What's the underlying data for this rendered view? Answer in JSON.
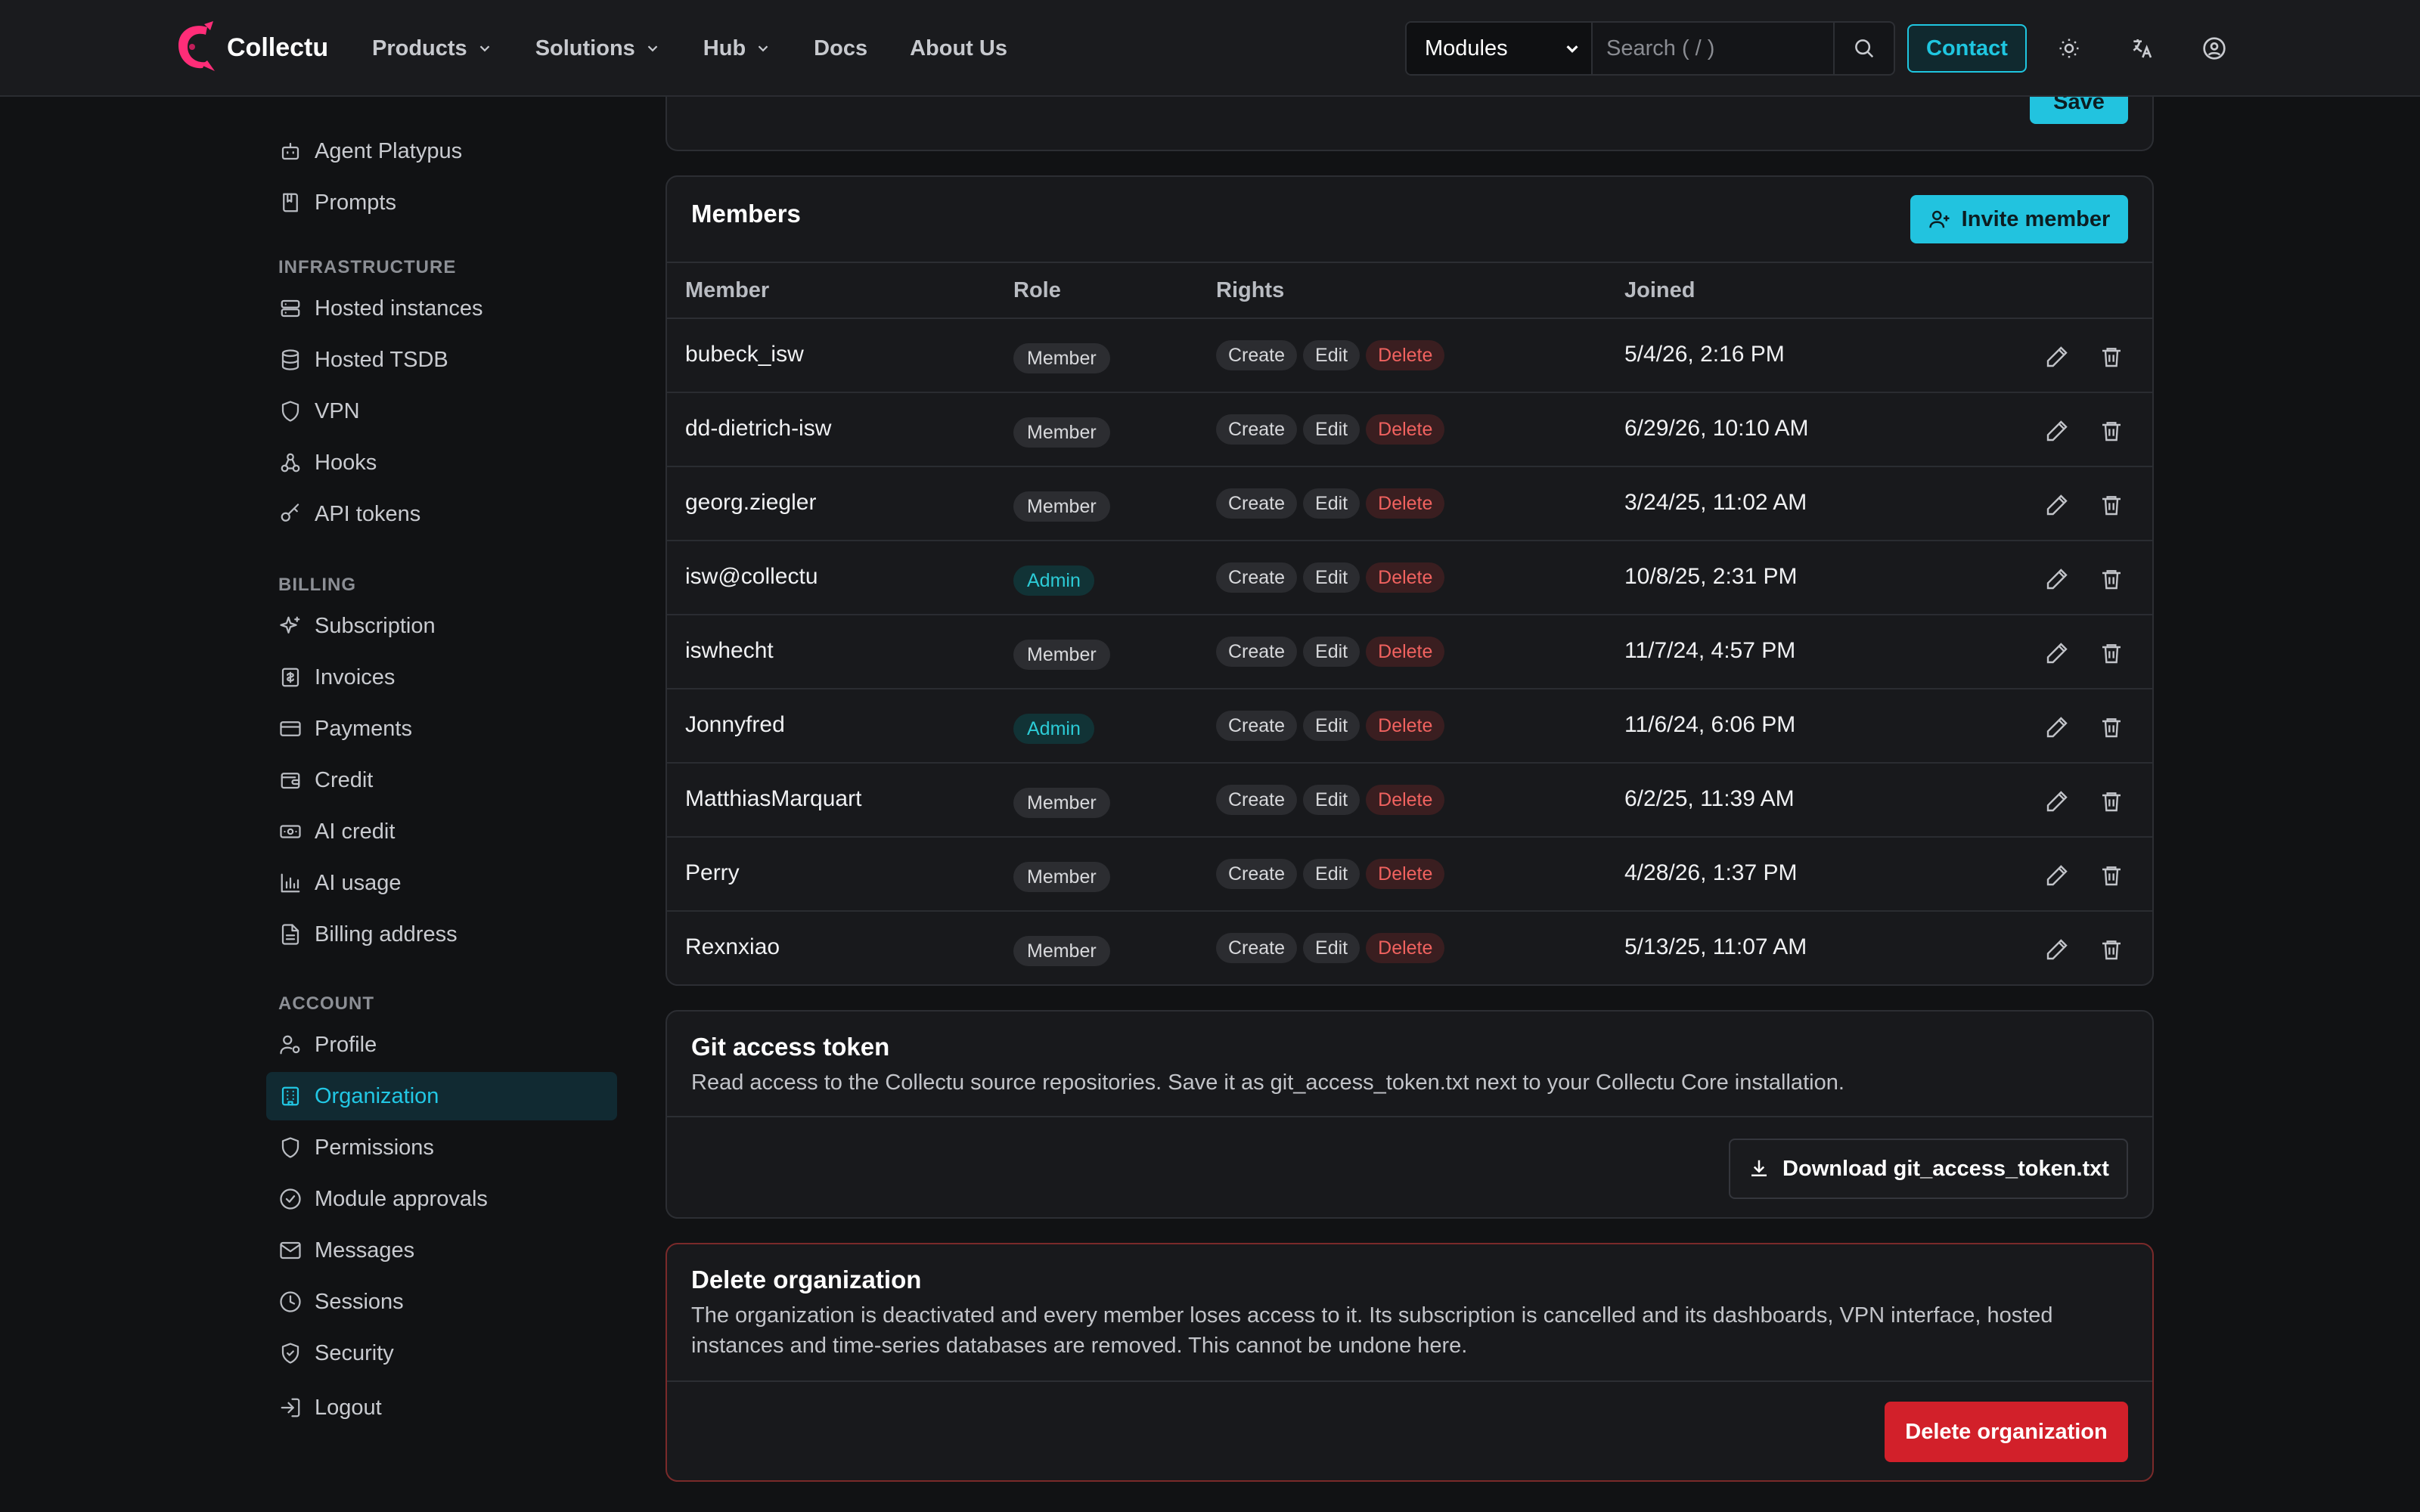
{
  "app": {
    "name": "Collectu",
    "brand_color": "#ff2d78",
    "accent": "#22c3df",
    "danger": "#d2202a"
  },
  "nav": {
    "items": [
      {
        "label": "Products",
        "dropdown": true
      },
      {
        "label": "Solutions",
        "dropdown": true
      },
      {
        "label": "Hub",
        "dropdown": true
      },
      {
        "label": "Docs",
        "dropdown": false
      },
      {
        "label": "About Us",
        "dropdown": false
      }
    ],
    "module_select": "Modules",
    "search_placeholder": "Search ( / )",
    "contact": "Contact",
    "icons": [
      "theme-sun-icon",
      "translate-icon",
      "account-icon"
    ]
  },
  "sidebar": {
    "items_top": [
      {
        "label": "Agent Platypus",
        "icon": "bot-icon"
      },
      {
        "label": "Prompts",
        "icon": "book-icon"
      }
    ],
    "infrastructure": {
      "heading": "INFRASTRUCTURE",
      "items": [
        {
          "label": "Hosted instances",
          "icon": "server-icon"
        },
        {
          "label": "Hosted TSDB",
          "icon": "database-icon"
        },
        {
          "label": "VPN",
          "icon": "shield-icon"
        },
        {
          "label": "Hooks",
          "icon": "webhook-icon"
        },
        {
          "label": "API tokens",
          "icon": "key-icon"
        }
      ]
    },
    "billing": {
      "heading": "BILLING",
      "items": [
        {
          "label": "Subscription",
          "icon": "sparkles-icon"
        },
        {
          "label": "Invoices",
          "icon": "invoice-icon"
        },
        {
          "label": "Payments",
          "icon": "credit-card-icon"
        },
        {
          "label": "Credit",
          "icon": "wallet-icon"
        },
        {
          "label": "AI credit",
          "icon": "banknote-icon"
        },
        {
          "label": "AI usage",
          "icon": "bar-chart-icon"
        },
        {
          "label": "Billing address",
          "icon": "file-text-icon"
        }
      ]
    },
    "account": {
      "heading": "ACCOUNT",
      "items": [
        {
          "label": "Profile",
          "icon": "user-cog-icon"
        },
        {
          "label": "Organization",
          "icon": "building-icon",
          "active": true
        },
        {
          "label": "Permissions",
          "icon": "shield-icon"
        },
        {
          "label": "Module approvals",
          "icon": "check-circle-icon"
        },
        {
          "label": "Messages",
          "icon": "mail-icon"
        },
        {
          "label": "Sessions",
          "icon": "clock-icon"
        },
        {
          "label": "Security",
          "icon": "shield-check-icon"
        }
      ]
    },
    "logout": {
      "label": "Logout",
      "icon": "logout-icon"
    }
  },
  "save_card": {
    "button": "Save"
  },
  "members": {
    "title": "Members",
    "invite": "Invite member",
    "columns": [
      "Member",
      "Role",
      "Rights",
      "Joined"
    ],
    "rights_labels": [
      "Create",
      "Edit",
      "Delete"
    ],
    "rows": [
      {
        "member": "bubeck_isw",
        "role": "Member",
        "joined": "5/4/26, 2:16 PM"
      },
      {
        "member": "dd-dietrich-isw",
        "role": "Member",
        "joined": "6/29/26, 10:10 AM"
      },
      {
        "member": "georg.ziegler",
        "role": "Member",
        "joined": "3/24/25, 11:02 AM"
      },
      {
        "member": "isw@collectu",
        "role": "Admin",
        "joined": "10/8/25, 2:31 PM"
      },
      {
        "member": "iswhecht",
        "role": "Member",
        "joined": "11/7/24, 4:57 PM"
      },
      {
        "member": "Jonnyfred",
        "role": "Admin",
        "joined": "11/6/24, 6:06 PM"
      },
      {
        "member": "MatthiasMarquart",
        "role": "Member",
        "joined": "6/2/25, 11:39 AM"
      },
      {
        "member": "Perry",
        "role": "Member",
        "joined": "4/28/26, 1:37 PM"
      },
      {
        "member": "Rexnxiao",
        "role": "Member",
        "joined": "5/13/25, 11:07 AM"
      }
    ]
  },
  "git_token": {
    "title": "Git access token",
    "description": "Read access to the Collectu source repositories. Save it as git_access_token.txt next to your Collectu Core installation.",
    "button": "Download git_access_token.txt"
  },
  "delete_org": {
    "title": "Delete organization",
    "description_line1": "The organization is deactivated and every member loses access to it. Its subscription is cancelled and its dashboards, VPN interface, hosted",
    "description_line2": "instances and time-series databases are removed. This cannot be undone here.",
    "button": "Delete organization"
  }
}
